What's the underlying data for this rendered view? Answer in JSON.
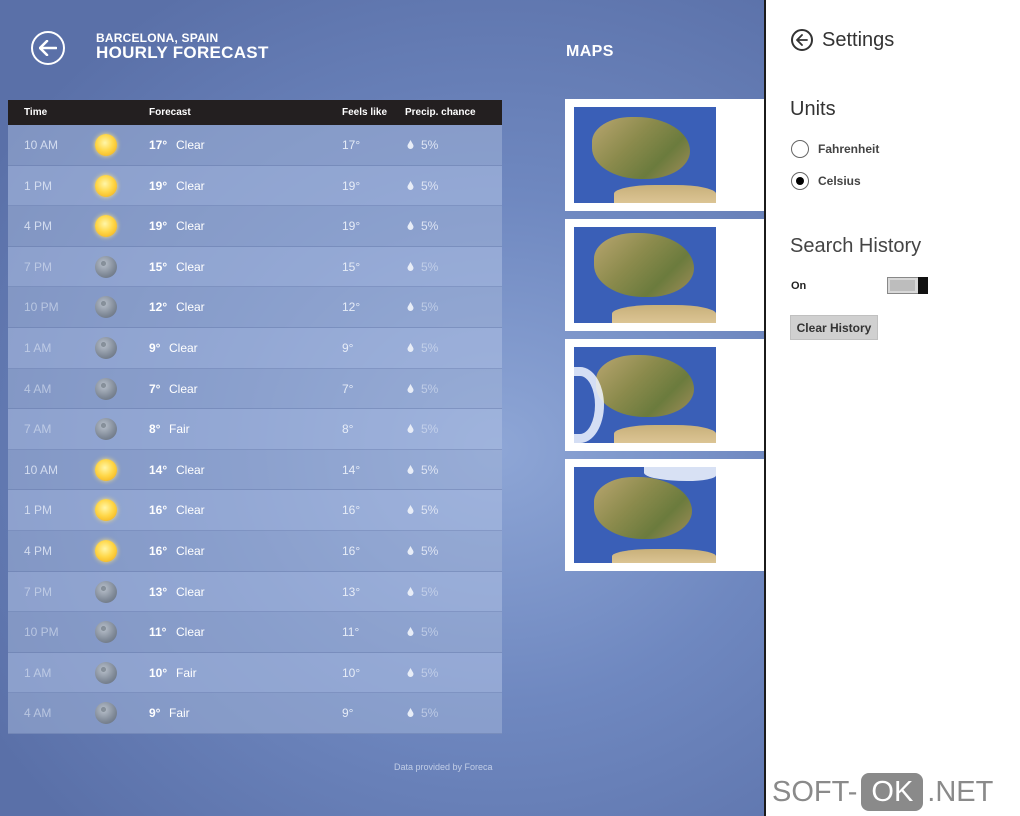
{
  "header": {
    "location": "BARCELONA, SPAIN",
    "title": "HOURLY FORECAST",
    "maps_title": "MAPS"
  },
  "table": {
    "columns": [
      "Time",
      "Forecast",
      "Feels like",
      "Precip. chance"
    ],
    "rows": [
      {
        "time": "10 AM",
        "icon": "sun-icon",
        "temp": "17°",
        "cond": "Clear",
        "feels": "17°",
        "precip": "5%"
      },
      {
        "time": "1 PM",
        "icon": "sun-icon",
        "temp": "19°",
        "cond": "Clear",
        "feels": "19°",
        "precip": "5%"
      },
      {
        "time": "4 PM",
        "icon": "sun-icon",
        "temp": "19°",
        "cond": "Clear",
        "feels": "19°",
        "precip": "5%"
      },
      {
        "time": "7 PM",
        "icon": "moon-icon",
        "temp": "15°",
        "cond": "Clear",
        "feels": "15°",
        "precip": "5%"
      },
      {
        "time": "10 PM",
        "icon": "moon-icon",
        "temp": "12°",
        "cond": "Clear",
        "feels": "12°",
        "precip": "5%"
      },
      {
        "time": "1 AM",
        "icon": "moon-icon",
        "temp": "9°",
        "cond": "Clear",
        "feels": "9°",
        "precip": "5%"
      },
      {
        "time": "4 AM",
        "icon": "moon-icon",
        "temp": "7°",
        "cond": "Clear",
        "feels": "7°",
        "precip": "5%"
      },
      {
        "time": "7 AM",
        "icon": "moon-icon",
        "temp": "8°",
        "cond": "Fair",
        "feels": "8°",
        "precip": "5%"
      },
      {
        "time": "10 AM",
        "icon": "sun-icon",
        "temp": "14°",
        "cond": "Clear",
        "feels": "14°",
        "precip": "5%"
      },
      {
        "time": "1 PM",
        "icon": "sun-icon",
        "temp": "16°",
        "cond": "Clear",
        "feels": "16°",
        "precip": "5%"
      },
      {
        "time": "4 PM",
        "icon": "sun-icon",
        "temp": "16°",
        "cond": "Clear",
        "feels": "16°",
        "precip": "5%"
      },
      {
        "time": "7 PM",
        "icon": "moon-icon",
        "temp": "13°",
        "cond": "Clear",
        "feels": "13°",
        "precip": "5%"
      },
      {
        "time": "10 PM",
        "icon": "moon-icon",
        "temp": "11°",
        "cond": "Clear",
        "feels": "11°",
        "precip": "5%"
      },
      {
        "time": "1 AM",
        "icon": "moon-icon",
        "temp": "10°",
        "cond": "Fair",
        "feels": "10°",
        "precip": "5%"
      },
      {
        "time": "4 AM",
        "icon": "moon-icon",
        "temp": "9°",
        "cond": "Fair",
        "feels": "9°",
        "precip": "5%"
      }
    ],
    "credit": "Data provided by Foreca"
  },
  "settings": {
    "title": "Settings",
    "units_heading": "Units",
    "unit_options": [
      {
        "label": "Fahrenheit",
        "checked": false
      },
      {
        "label": "Celsius",
        "checked": true
      }
    ],
    "search_history_heading": "Search History",
    "toggle_label": "On",
    "clear_button": "Clear History"
  },
  "watermark": {
    "left": "SOFT-",
    "mid": "OK",
    "right": ".NET"
  },
  "colors": {
    "header_row": "#231f20",
    "panel_bg": "#ffffff",
    "sun": "#ffd84a"
  }
}
